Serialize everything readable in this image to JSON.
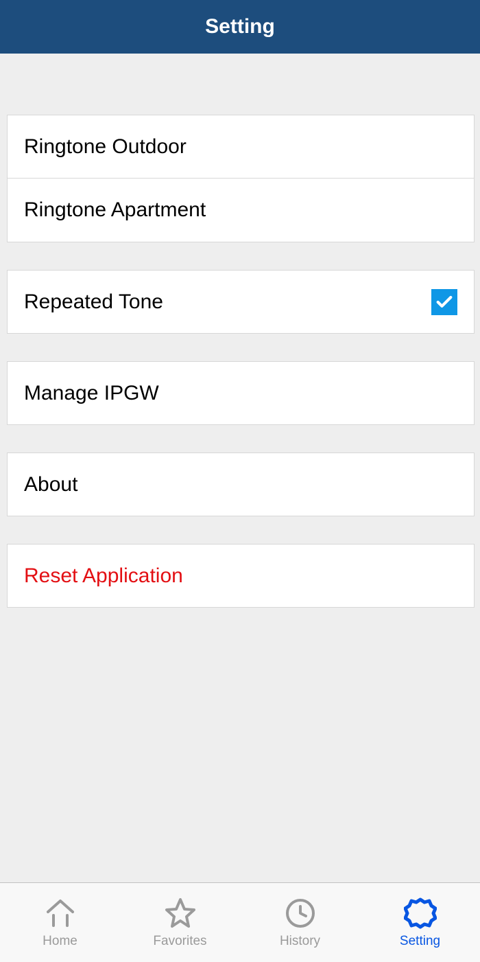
{
  "header": {
    "title": "Setting"
  },
  "settings": {
    "ringtone_outdoor": "Ringtone Outdoor",
    "ringtone_apartment": "Ringtone Apartment",
    "repeated_tone": "Repeated Tone",
    "repeated_tone_enabled": true,
    "manage_ipgw": "Manage IPGW",
    "about": "About",
    "reset_application": "Reset Application"
  },
  "tabs": {
    "home": "Home",
    "favorites": "Favorites",
    "history": "History",
    "setting": "Setting"
  }
}
